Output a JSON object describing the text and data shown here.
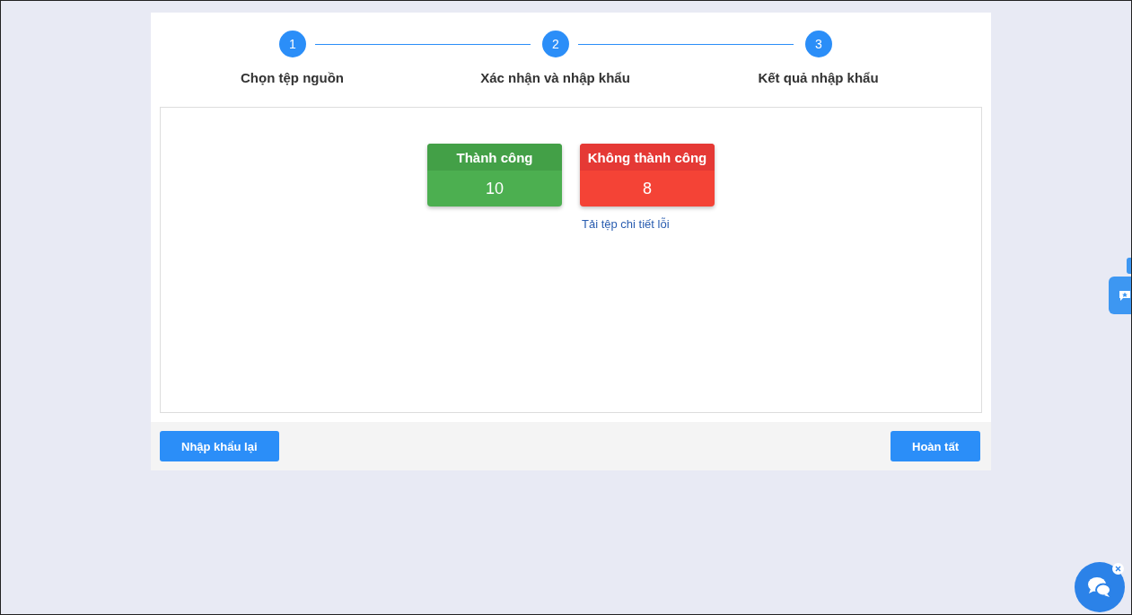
{
  "steps": [
    {
      "number": "1",
      "label": "Chọn tệp nguồn",
      "active": true
    },
    {
      "number": "2",
      "label": "Xác nhận và nhập khẩu",
      "active": true
    },
    {
      "number": "3",
      "label": "Kết quả nhập khẩu",
      "active": true
    }
  ],
  "results": [
    {
      "kind": "success",
      "title": "Thành công",
      "count": "10"
    },
    {
      "kind": "failure",
      "title": "Không thành công",
      "count": "8",
      "link": "Tải tệp chi tiết lỗi"
    }
  ],
  "footer": {
    "back_button": "Nhập khẩu lại",
    "finish_button": "Hoàn tất"
  }
}
